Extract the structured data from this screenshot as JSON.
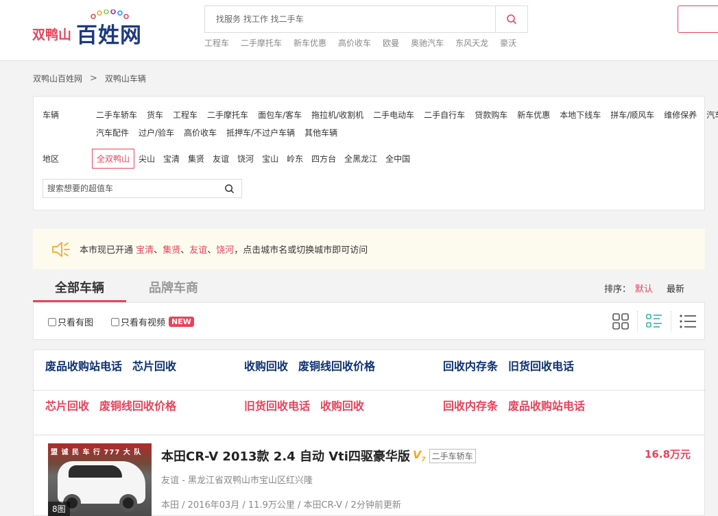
{
  "header": {
    "logo_city": "双鸭山",
    "logo_main": "百姓网",
    "search_placeholder": "找服务 找工作 找二手车",
    "hot_links": [
      "工程车",
      "二手摩托车",
      "新车优惠",
      "高价收车",
      "欧曼",
      "奥驰汽车",
      "东风天龙",
      "豪沃"
    ]
  },
  "breadcrumb": [
    "双鸭山百姓网",
    "双鸭山车辆"
  ],
  "filter": {
    "vehicle_label": "车辆",
    "vehicle_row1": [
      "二手车轿车",
      "货车",
      "工程车",
      "二手摩托车",
      "面包车/客车",
      "拖拉机/收割机",
      "二手电动车",
      "二手自行车",
      "贷款购车",
      "新车优惠",
      "本地下线车",
      "拼车/顺风车",
      "维修保养",
      "汽车"
    ],
    "vehicle_row2": [
      "汽车配件",
      "过户/验车",
      "高价收车",
      "抵押车/不过户车辆",
      "其他车辆"
    ],
    "area_label": "地区",
    "area_active": "全双鸭山",
    "areas": [
      "尖山",
      "宝清",
      "集贤",
      "友谊",
      "饶河",
      "宝山",
      "岭东",
      "四方台",
      "全黑龙江",
      "全中国"
    ],
    "search_placeholder": "搜索想要的超值车"
  },
  "notice": {
    "prefix": "本市现已开通",
    "cities": [
      "宝清",
      "集贤",
      "友谊",
      "饶河"
    ],
    "sep": "、",
    "suffix": "，点击城市名或切换城市即可访问"
  },
  "tabs": {
    "all": "全部车辆",
    "brand": "品牌车商",
    "sort_label": "排序：",
    "sort_default": "默认",
    "sort_latest": "最新"
  },
  "toolbar": {
    "only_images": "只看有图",
    "only_video": "只看有视频",
    "new_badge": "NEW"
  },
  "ads": {
    "row1": [
      "废品收购站电话",
      "芯片回收",
      "收购回收",
      "废铜线回收价格",
      "回收内存条",
      "旧货回收电话"
    ],
    "row2": [
      "芯片回收",
      "废铜线回收价格",
      "旧货回收电话",
      "收购回收",
      "回收内存条",
      "废品收购站电话"
    ]
  },
  "listing": {
    "title": "本田CR-V 2013款 2.4 自动 Vti四驱豪华版",
    "vip": "V",
    "vip_level": "7",
    "category": "二手车轿车",
    "price": "16.8万元",
    "location": "友谊 - 黑龙江省双鸭山市宝山区红兴隆",
    "meta": "本田 / 2016年03月 / 11.9万公里 / 本田CR-V / 2分钟前更新",
    "photo_count": "8图",
    "photo_sign": "盟 诚 民 车 行 777 大 队"
  },
  "colors": {
    "accent": "#e8425a",
    "logo_blue": "#1d3a80",
    "ad_blue": "#0d3172",
    "notice_bg": "#fdfbee",
    "vip": "#f5a623",
    "list_view_active": "#2bb3a3"
  }
}
